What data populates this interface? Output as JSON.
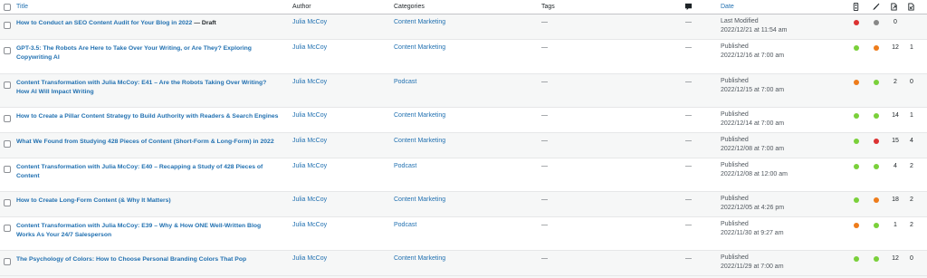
{
  "header": {
    "title": "Title",
    "author": "Author",
    "categories": "Categories",
    "tags": "Tags",
    "date": "Date"
  },
  "header_icons": [
    "comment-icon",
    "seo-score-icon",
    "readability-icon",
    "outgoing-links-icon",
    "incoming-links-icon"
  ],
  "colors": {
    "green": "#7ad03a",
    "orange": "#ee7c1b",
    "red": "#dc3232",
    "gray": "#888888",
    "link": "#2271b1"
  },
  "rows": [
    {
      "title": "How to Conduct an SEO Content Audit for Your Blog in 2022",
      "state": " — Draft",
      "author": "Julia McCoy",
      "category": "Content Marketing",
      "tags": "—",
      "comments": "—",
      "status": "Last Modified",
      "date": "2022/12/21 at 11:54 am",
      "seo": "red",
      "readability": "gray",
      "links": "0",
      "linked": ""
    },
    {
      "title": "GPT-3.5: The Robots Are Here to Take Over Your Writing, or Are They? Exploring Copywriting AI",
      "state": "",
      "author": "Julia McCoy",
      "category": "Content Marketing",
      "tags": "—",
      "comments": "—",
      "status": "Published",
      "date": "2022/12/16 at 7:00 am",
      "seo": "green",
      "readability": "orange",
      "links": "12",
      "linked": "1"
    },
    {
      "title": "Content Transformation with Julia McCoy: E41 – Are the Robots Taking Over Writing? How AI Will Impact Writing",
      "state": "",
      "author": "Julia McCoy",
      "category": "Podcast",
      "tags": "—",
      "comments": "—",
      "status": "Published",
      "date": "2022/12/15 at 7:00 am",
      "seo": "orange",
      "readability": "green",
      "links": "2",
      "linked": "0"
    },
    {
      "title": "How to Create a Pillar Content Strategy to Build Authority with Readers & Search Engines",
      "state": "",
      "author": "Julia McCoy",
      "category": "Content Marketing",
      "tags": "—",
      "comments": "—",
      "status": "Published",
      "date": "2022/12/14 at 7:00 am",
      "seo": "green",
      "readability": "green",
      "links": "14",
      "linked": "1"
    },
    {
      "title": "What We Found from Studying 428 Pieces of Content (Short-Form & Long-Form) in 2022",
      "state": "",
      "author": "Julia McCoy",
      "category": "Content Marketing",
      "tags": "—",
      "comments": "—",
      "status": "Published",
      "date": "2022/12/08 at 7:00 am",
      "seo": "green",
      "readability": "red",
      "links": "15",
      "linked": "4"
    },
    {
      "title": "Content Transformation with Julia McCoy: E40 – Recapping a Study of 428 Pieces of Content",
      "state": "",
      "author": "Julia McCoy",
      "category": "Podcast",
      "tags": "—",
      "comments": "—",
      "status": "Published",
      "date": "2022/12/08 at 12:00 am",
      "seo": "green",
      "readability": "green",
      "links": "4",
      "linked": "2"
    },
    {
      "title": "How to Create Long-Form Content (& Why It Matters)",
      "state": "",
      "author": "Julia McCoy",
      "category": "Content Marketing",
      "tags": "—",
      "comments": "—",
      "status": "Published",
      "date": "2022/12/05 at 4:26 pm",
      "seo": "green",
      "readability": "orange",
      "links": "18",
      "linked": "2"
    },
    {
      "title": "Content Transformation with Julia McCoy: E39 – Why & How ONE Well-Written Blog Works As Your 24/7 Salesperson",
      "state": "",
      "author": "Julia McCoy",
      "category": "Podcast",
      "tags": "—",
      "comments": "—",
      "status": "Published",
      "date": "2022/11/30 at 9:27 am",
      "seo": "orange",
      "readability": "green",
      "links": "1",
      "linked": "2"
    },
    {
      "title": "The Psychology of Colors: How to Choose Personal Branding Colors That Pop",
      "state": "",
      "author": "Julia McCoy",
      "category": "Content Marketing",
      "tags": "—",
      "comments": "—",
      "status": "Published",
      "date": "2022/11/29 at 7:00 am",
      "seo": "green",
      "readability": "green",
      "links": "12",
      "linked": "0"
    }
  ]
}
